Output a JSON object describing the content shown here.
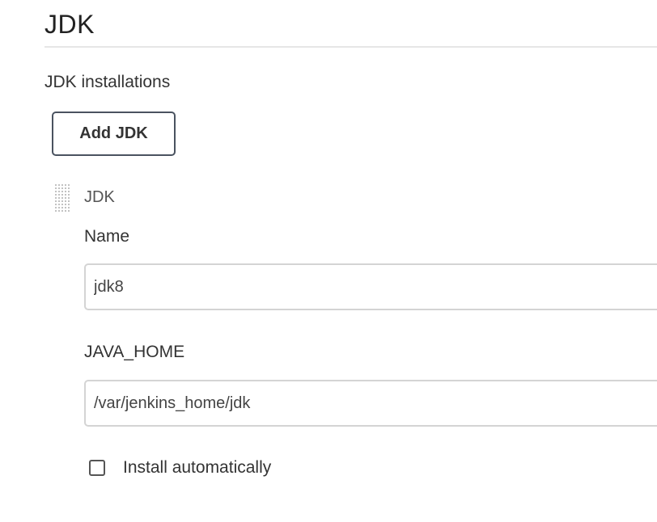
{
  "section": {
    "title": "JDK",
    "group_label": "JDK installations",
    "add_button_label": "Add JDK"
  },
  "installation": {
    "header": "JDK",
    "name_label": "Name",
    "name_value": "jdk8",
    "java_home_label": "JAVA_HOME",
    "java_home_value": "/var/jenkins_home/jdk",
    "install_auto_label": "Install automatically",
    "install_auto_checked": false
  }
}
